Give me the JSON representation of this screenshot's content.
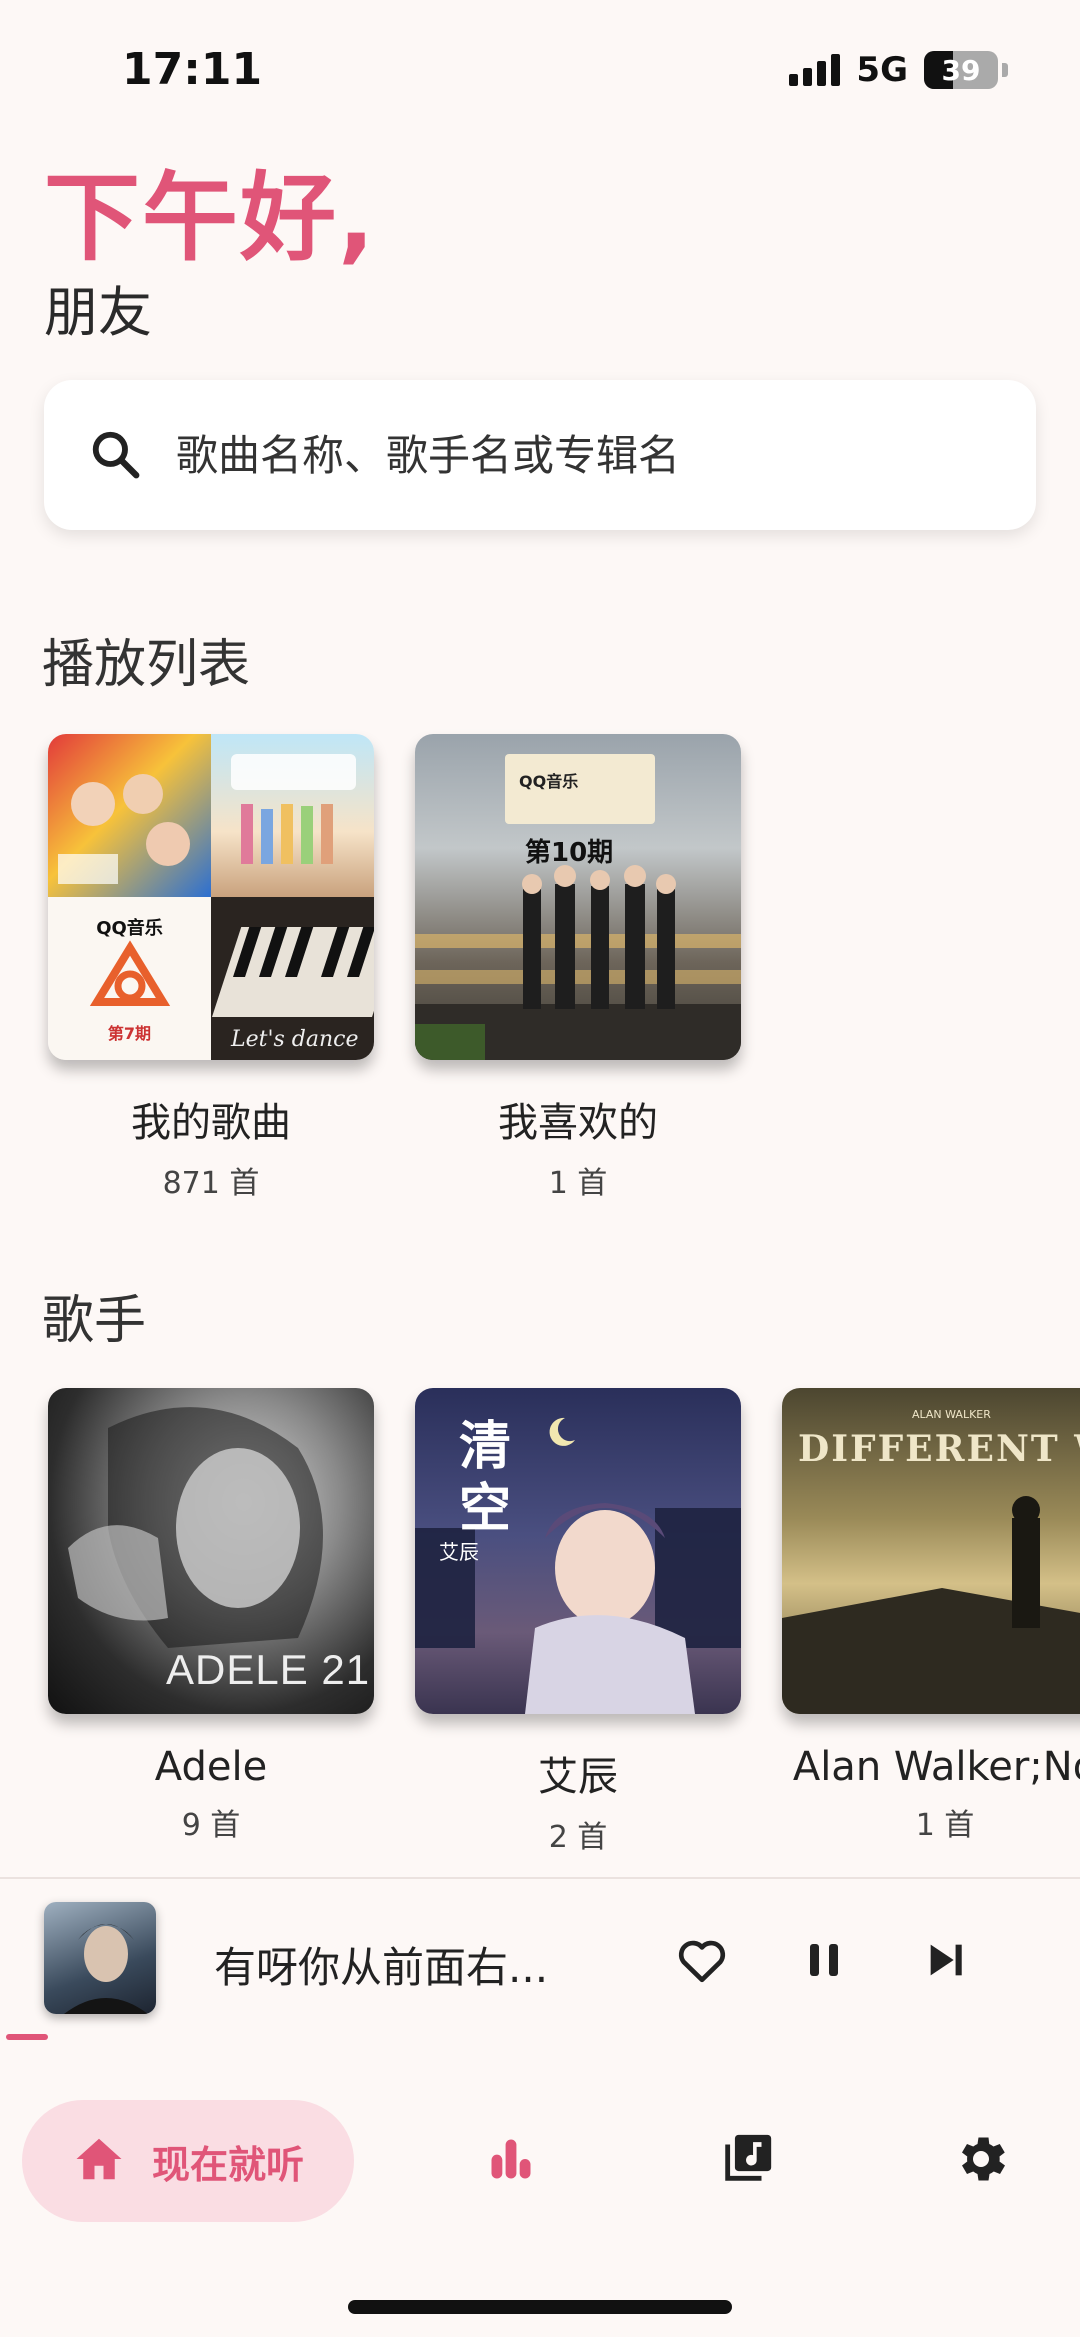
{
  "status_bar": {
    "time": "17:11",
    "network": "5G",
    "battery": "39",
    "battery_level": 0.39
  },
  "greeting": {
    "title": "下午好,",
    "subtitle": "朋友"
  },
  "search": {
    "placeholder": "歌曲名称、歌手名或专辑名"
  },
  "playlists": {
    "title": "播放列表",
    "items": [
      {
        "name": "我的歌曲",
        "count": "871 首"
      },
      {
        "name": "我喜欢的",
        "count": "1 首"
      }
    ]
  },
  "artists": {
    "title": "歌手",
    "items": [
      {
        "name": "Adele",
        "count": "9 首",
        "cover_text": "ADELE 21"
      },
      {
        "name": "艾辰",
        "count": "2 首",
        "cover_text": "清空",
        "cover_sub": "艾辰"
      },
      {
        "name": "Alan Walker;No",
        "count": "1 首",
        "cover_text": "DIFFERENT WORLD",
        "cover_sub": "ALAN WALKER"
      }
    ]
  },
  "covers": {
    "qq_label": "QQ音乐",
    "episode_10": "第10期",
    "episode_7": "第7期",
    "lets_dance": "Let's dance"
  },
  "player": {
    "title": "有呀你从前面右...",
    "progress": 0.04
  },
  "nav": {
    "home_label": "现在就听"
  },
  "colors": {
    "accent": "#e05578",
    "accent_bg": "#fadde3",
    "background": "#fdf8f6"
  },
  "icons": [
    "search-icon",
    "heart-icon",
    "pause-icon",
    "skip-next-icon",
    "home-icon",
    "bar-chart-icon",
    "music-library-icon",
    "settings-icon"
  ]
}
